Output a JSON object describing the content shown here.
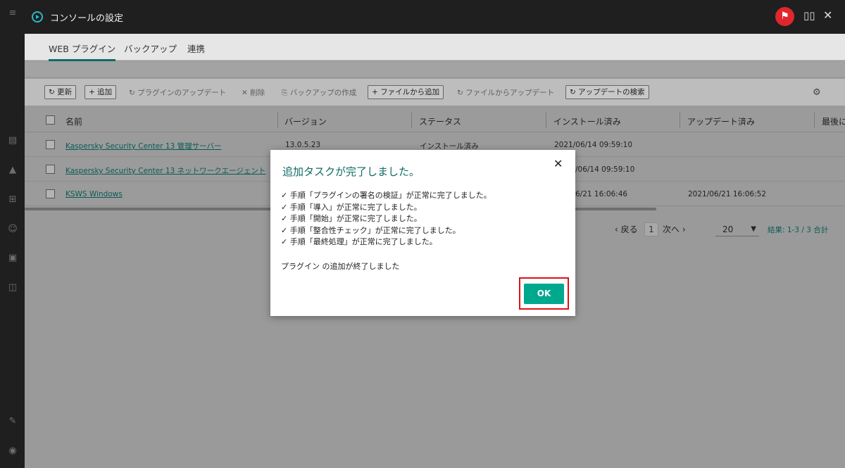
{
  "window": {
    "title": "コンソールの設定"
  },
  "topbar_icons": [
    "play-circle-icon",
    "flag-icon",
    "book-icon",
    "close-icon"
  ],
  "tabs": [
    {
      "label": "WEB プラグイン",
      "active": true
    },
    {
      "label": "バックアップ",
      "active": false
    },
    {
      "label": "連携",
      "active": false
    }
  ],
  "toolbar": {
    "refresh": "↻ 更新",
    "add": "+ 追加",
    "update_plugin": "↻ プラグインのアップデート",
    "delete": "✕ 削除",
    "create_backup": "⎘ バックアップの作成",
    "add_from_file": "+ ファイルから追加",
    "update_from_file": "↻ ファイルからアップデート",
    "check_updates": "↻ アップデートの検索"
  },
  "table": {
    "columns": [
      "名前",
      "バージョン",
      "ステータス",
      "インストール済み",
      "アップデート済み",
      "最後に"
    ],
    "rows": [
      {
        "name": "Kaspersky Security Center 13 管理サーバー",
        "version": "13.0.5.23",
        "status": "インストール済み",
        "installed": "2021/06/14 09:59:10",
        "updated": ""
      },
      {
        "name": "Kaspersky Security Center 13 ネットワークエージェント",
        "version": "",
        "status": "",
        "installed": "/06/14 09:59:10",
        "updated": ""
      },
      {
        "name": "KSWS Windows",
        "version": "",
        "status": "",
        "installed": "6/21 16:06:46",
        "updated": "2021/06/21 16:06:52"
      }
    ]
  },
  "pagination": {
    "prev": "‹ 戻る",
    "page": "1",
    "next": "次へ ›",
    "per_page": "20",
    "results": "結果: 1-3 / 3 合計"
  },
  "dialog": {
    "title": "追加タスクが完了しました。",
    "lines": [
      "✓ 手順「プラグインの署名の検証」が正常に完了しました。",
      "✓ 手順「導入」が正常に完了しました。",
      "✓ 手順「開始」が正常に完了しました。",
      "✓ 手順「整合性チェック」が正常に完了しました。",
      "✓ 手順「最終処理」が正常に完了しました。"
    ],
    "message": "プラグイン の追加が終了しました",
    "ok_label": "OK"
  },
  "colors": {
    "accent": "#106a64",
    "ok_button": "#00a88e",
    "highlight": "#e0101a",
    "flag": "#e1262d"
  }
}
